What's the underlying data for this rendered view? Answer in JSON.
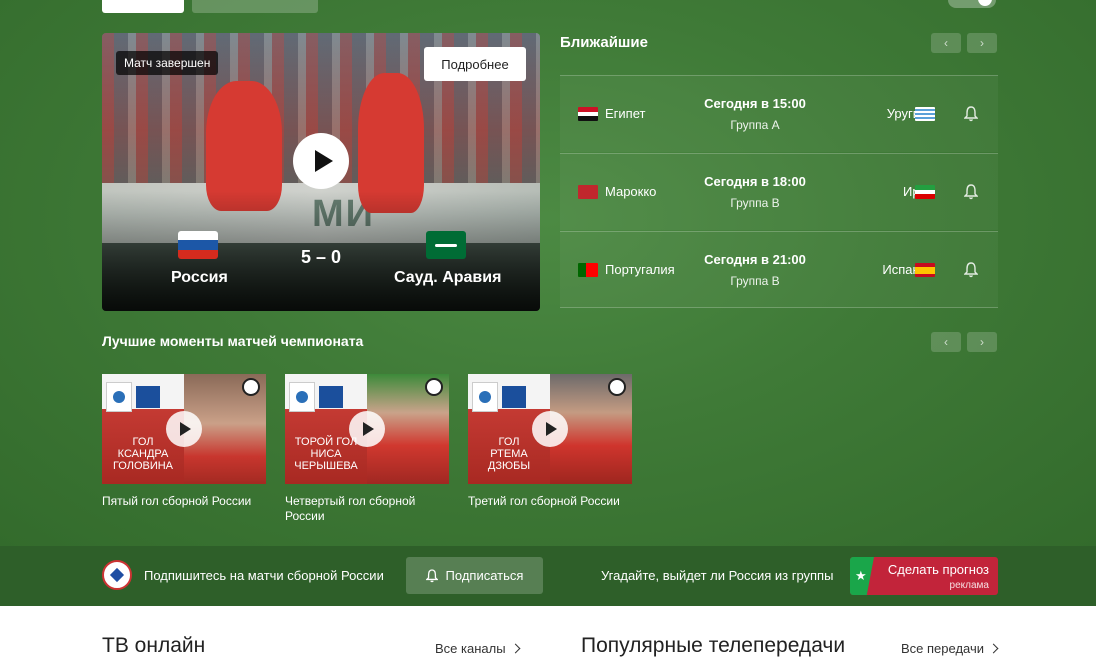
{
  "hero": {
    "status_badge": "Матч завершен",
    "details_button": "Подробнее",
    "home_team": "Россия",
    "away_team": "Сауд. Аравия",
    "score": "5 – 0",
    "board_text": "МИ"
  },
  "upcoming": {
    "title": "Ближайшие",
    "matches": [
      {
        "home": "Египет",
        "time": "Сегодня в 15:00",
        "group": "Группа А",
        "away": "Уругвай"
      },
      {
        "home": "Марокко",
        "time": "Сегодня в 18:00",
        "group": "Группа B",
        "away": "Иран"
      },
      {
        "home": "Португалия",
        "time": "Сегодня в 21:00",
        "group": "Группа B",
        "away": "Испания"
      }
    ]
  },
  "highlights": {
    "title": "Лучшие моменты матчей чемпионата",
    "items": [
      {
        "caption": "Пятый гол сборной России",
        "thumb_text": "ГОЛ\nКСАНДРА ГОЛОВИНА"
      },
      {
        "caption": "Четвертый гол сборной России",
        "thumb_text": "ТОРОЙ ГОЛ\nНИСА ЧЕРЫШЕВА"
      },
      {
        "caption": "Третий гол сборной России",
        "thumb_text": "ГОЛ\nРТЕМА ДЗЮБЫ"
      }
    ]
  },
  "subscribe_bar": {
    "text": "Подпишитесь на матчи сборной России",
    "button": "Подписаться",
    "guess_text": "Угадайте, выйдет ли Россия из группы",
    "predict_button": "Сделать прогноз",
    "ad_label": "реклама"
  },
  "bottom": {
    "tv_title": "ТВ онлайн",
    "tv_link": "Все каналы",
    "popular_title": "Популярные телепередачи",
    "popular_link": "Все передачи"
  },
  "arrows": {
    "prev": "‹",
    "next": "›"
  },
  "colors": {
    "field_green": "#3f7a37",
    "bar_green": "#2e5f29",
    "predict_red": "#c2243a",
    "predict_green": "#1aa64a"
  }
}
